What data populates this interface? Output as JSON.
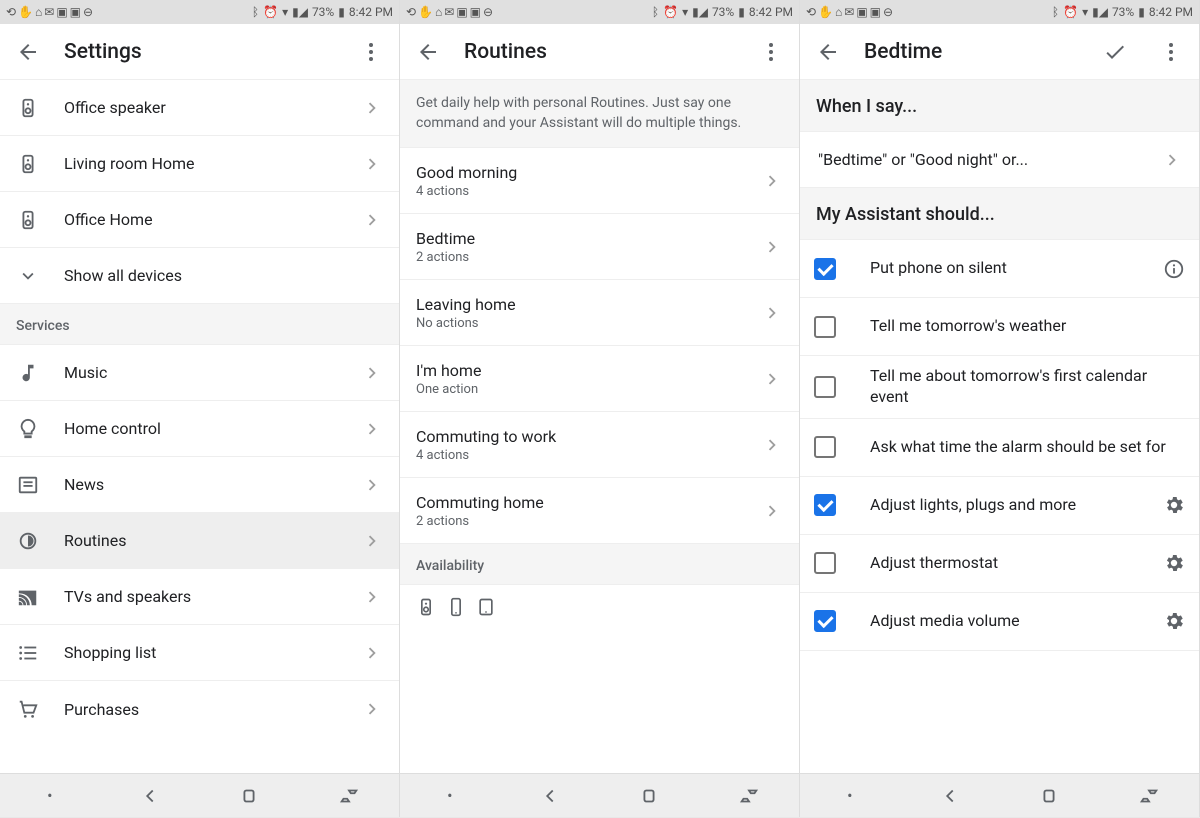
{
  "status": {
    "battery": "73%",
    "time": "8:42 PM"
  },
  "screen1": {
    "title": "Settings",
    "devices": [
      {
        "label": "Office speaker"
      },
      {
        "label": "Living room Home"
      },
      {
        "label": "Office Home"
      }
    ],
    "show_all": "Show all devices",
    "services_header": "Services",
    "services": [
      {
        "label": "Music",
        "icon": "music"
      },
      {
        "label": "Home control",
        "icon": "bulb"
      },
      {
        "label": "News",
        "icon": "news"
      },
      {
        "label": "Routines",
        "icon": "routines",
        "selected": true
      },
      {
        "label": "TVs and speakers",
        "icon": "cast"
      },
      {
        "label": "Shopping list",
        "icon": "list"
      },
      {
        "label": "Purchases",
        "icon": "cart"
      }
    ]
  },
  "screen2": {
    "title": "Routines",
    "description": "Get daily help with personal Routines. Just say one command and your Assistant will do multiple things.",
    "routines": [
      {
        "name": "Good morning",
        "actions": "4 actions"
      },
      {
        "name": "Bedtime",
        "actions": "2 actions"
      },
      {
        "name": "Leaving home",
        "actions": "No actions"
      },
      {
        "name": "I'm home",
        "actions": "One action"
      },
      {
        "name": "Commuting to work",
        "actions": "4 actions"
      },
      {
        "name": "Commuting home",
        "actions": "2 actions"
      }
    ],
    "availability_header": "Availability"
  },
  "screen3": {
    "title": "Bedtime",
    "when_header": "When I say...",
    "when_phrase": "\"Bedtime\" or \"Good night\" or...",
    "should_header": "My Assistant should...",
    "actions": [
      {
        "label": "Put phone on silent",
        "checked": true,
        "trailing": "info"
      },
      {
        "label": "Tell me tomorrow's weather",
        "checked": false
      },
      {
        "label": "Tell me about tomorrow's first calendar event",
        "checked": false
      },
      {
        "label": "Ask what time the alarm should be set for",
        "checked": false
      },
      {
        "label": "Adjust lights, plugs and more",
        "checked": true,
        "trailing": "gear"
      },
      {
        "label": "Adjust thermostat",
        "checked": false,
        "trailing": "gear"
      },
      {
        "label": "Adjust media volume",
        "checked": true,
        "trailing": "gear"
      }
    ]
  }
}
